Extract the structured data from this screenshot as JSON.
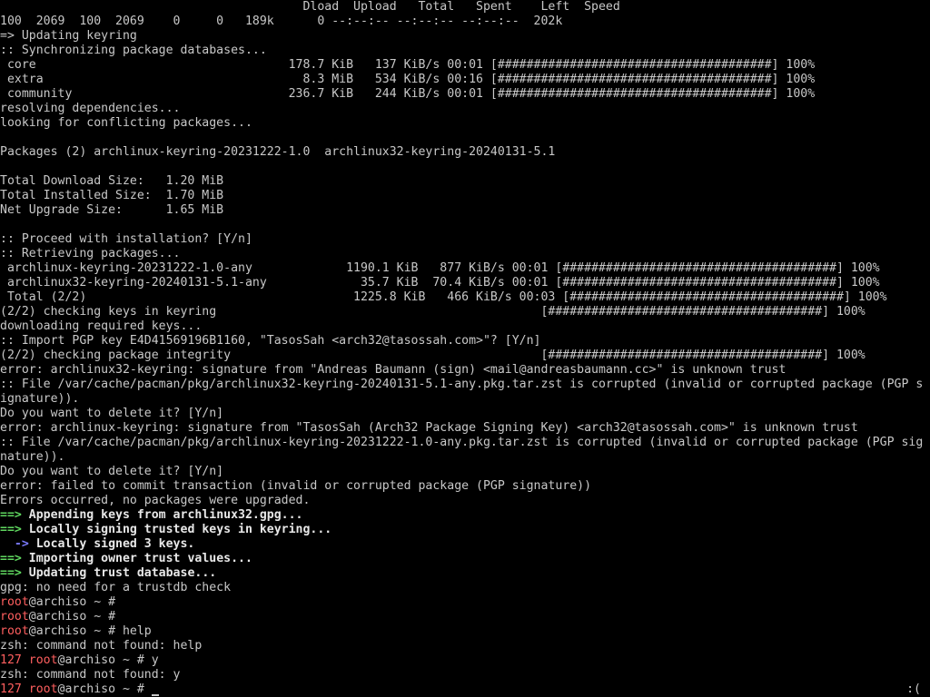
{
  "terminal": {
    "colors": {
      "background": "#000000",
      "foreground": "#c8c8c8",
      "arrow_green": "#5fd75f",
      "arrow_blue": "#7b7bff",
      "prompt_red": "#ff5f5f"
    },
    "status_indicator": ":(",
    "lines": [
      [
        {
          "text": "                                          Dload  Upload   Total   Spent    Left  Speed",
          "style": "default"
        }
      ],
      [
        {
          "text": "100  2069  100  2069    0     0   189k      0 --:--:-- --:--:-- --:--:--  202k",
          "style": "default"
        }
      ],
      [
        {
          "text": "=> Updating keyring",
          "style": "default"
        }
      ],
      [
        {
          "text": ":: Synchronizing package databases...",
          "style": "default"
        }
      ],
      [
        {
          "text": " core                                   178.7 KiB   137 KiB/s 00:01 [######################################] 100%",
          "style": "default"
        }
      ],
      [
        {
          "text": " extra                                    8.3 MiB   534 KiB/s 00:16 [######################################] 100%",
          "style": "default"
        }
      ],
      [
        {
          "text": " community                              236.7 KiB   244 KiB/s 00:01 [######################################] 100%",
          "style": "default"
        }
      ],
      [
        {
          "text": "resolving dependencies...",
          "style": "default"
        }
      ],
      [
        {
          "text": "looking for conflicting packages...",
          "style": "default"
        }
      ],
      [
        {
          "text": "",
          "style": "default"
        }
      ],
      [
        {
          "text": "Packages (2) archlinux-keyring-20231222-1.0  archlinux32-keyring-20240131-5.1",
          "style": "default"
        }
      ],
      [
        {
          "text": "",
          "style": "default"
        }
      ],
      [
        {
          "text": "Total Download Size:   1.20 MiB",
          "style": "default"
        }
      ],
      [
        {
          "text": "Total Installed Size:  1.70 MiB",
          "style": "default"
        }
      ],
      [
        {
          "text": "Net Upgrade Size:      1.65 MiB",
          "style": "default"
        }
      ],
      [
        {
          "text": "",
          "style": "default"
        }
      ],
      [
        {
          "text": ":: Proceed with installation? [Y/n]",
          "style": "default"
        }
      ],
      [
        {
          "text": ":: Retrieving packages...",
          "style": "default"
        }
      ],
      [
        {
          "text": " archlinux-keyring-20231222-1.0-any             1190.1 KiB   877 KiB/s 00:01 [######################################] 100%",
          "style": "default"
        }
      ],
      [
        {
          "text": " archlinux32-keyring-20240131-5.1-any             35.7 KiB  70.4 KiB/s 00:01 [######################################] 100%",
          "style": "default"
        }
      ],
      [
        {
          "text": " Total (2/2)                                     1225.8 KiB   466 KiB/s 00:03 [######################################] 100%",
          "style": "default"
        }
      ],
      [
        {
          "text": "(2/2) checking keys in keyring                                             [######################################] 100%",
          "style": "default"
        }
      ],
      [
        {
          "text": "downloading required keys...",
          "style": "default"
        }
      ],
      [
        {
          "text": ":: Import PGP key E4D41569196B1160, \"TasosSah <arch32@tasossah.com>\"? [Y/n]",
          "style": "default"
        }
      ],
      [
        {
          "text": "(2/2) checking package integrity                                           [######################################] 100%",
          "style": "default"
        }
      ],
      [
        {
          "text": "error: archlinux32-keyring: signature from \"Andreas Baumann (sign) <mail@andreasbaumann.cc>\" is unknown trust",
          "style": "default"
        }
      ],
      [
        {
          "text": ":: File /var/cache/pacman/pkg/archlinux32-keyring-20240131-5.1-any.pkg.tar.zst is corrupted (invalid or corrupted package (PGP s",
          "style": "default"
        }
      ],
      [
        {
          "text": "ignature)).",
          "style": "default"
        }
      ],
      [
        {
          "text": "Do you want to delete it? [Y/n]",
          "style": "default"
        }
      ],
      [
        {
          "text": "error: archlinux-keyring: signature from \"TasosSah (Arch32 Package Signing Key) <arch32@tasossah.com>\" is unknown trust",
          "style": "default"
        }
      ],
      [
        {
          "text": ":: File /var/cache/pacman/pkg/archlinux-keyring-20231222-1.0-any.pkg.tar.zst is corrupted (invalid or corrupted package (PGP sig",
          "style": "default"
        }
      ],
      [
        {
          "text": "nature)).",
          "style": "default"
        }
      ],
      [
        {
          "text": "Do you want to delete it? [Y/n]",
          "style": "default"
        }
      ],
      [
        {
          "text": "error: failed to commit transaction (invalid or corrupted package (PGP signature))",
          "style": "default"
        }
      ],
      [
        {
          "text": "Errors occurred, no packages were upgraded.",
          "style": "default"
        }
      ],
      [
        {
          "text": "==>",
          "style": "green"
        },
        {
          "text": " Appending keys from archlinux32.gpg...",
          "style": "bold"
        }
      ],
      [
        {
          "text": "==>",
          "style": "green"
        },
        {
          "text": " Locally signing trusted keys in keyring...",
          "style": "bold"
        }
      ],
      [
        {
          "text": "  ->",
          "style": "blue"
        },
        {
          "text": " Locally signed 3 keys.",
          "style": "bold"
        }
      ],
      [
        {
          "text": "==>",
          "style": "green"
        },
        {
          "text": " Importing owner trust values...",
          "style": "bold"
        }
      ],
      [
        {
          "text": "==>",
          "style": "green"
        },
        {
          "text": " Updating trust database...",
          "style": "bold"
        }
      ],
      [
        {
          "text": "gpg: no need for a trustdb check",
          "style": "default"
        }
      ],
      [
        {
          "text": "root",
          "style": "red"
        },
        {
          "text": "@archiso ~ # ",
          "style": "default"
        }
      ],
      [
        {
          "text": "root",
          "style": "red"
        },
        {
          "text": "@archiso ~ # ",
          "style": "default"
        }
      ],
      [
        {
          "text": "root",
          "style": "red"
        },
        {
          "text": "@archiso ~ # help",
          "style": "default"
        }
      ],
      [
        {
          "text": "zsh: command not found: help",
          "style": "default"
        }
      ],
      [
        {
          "text": "127 root",
          "style": "red"
        },
        {
          "text": "@archiso ~ # y",
          "style": "default"
        }
      ],
      [
        {
          "text": "zsh: command not found: y",
          "style": "default"
        }
      ],
      [
        {
          "text": "127 root",
          "style": "red"
        },
        {
          "text": "@archiso ~ # ",
          "style": "default"
        }
      ]
    ]
  }
}
